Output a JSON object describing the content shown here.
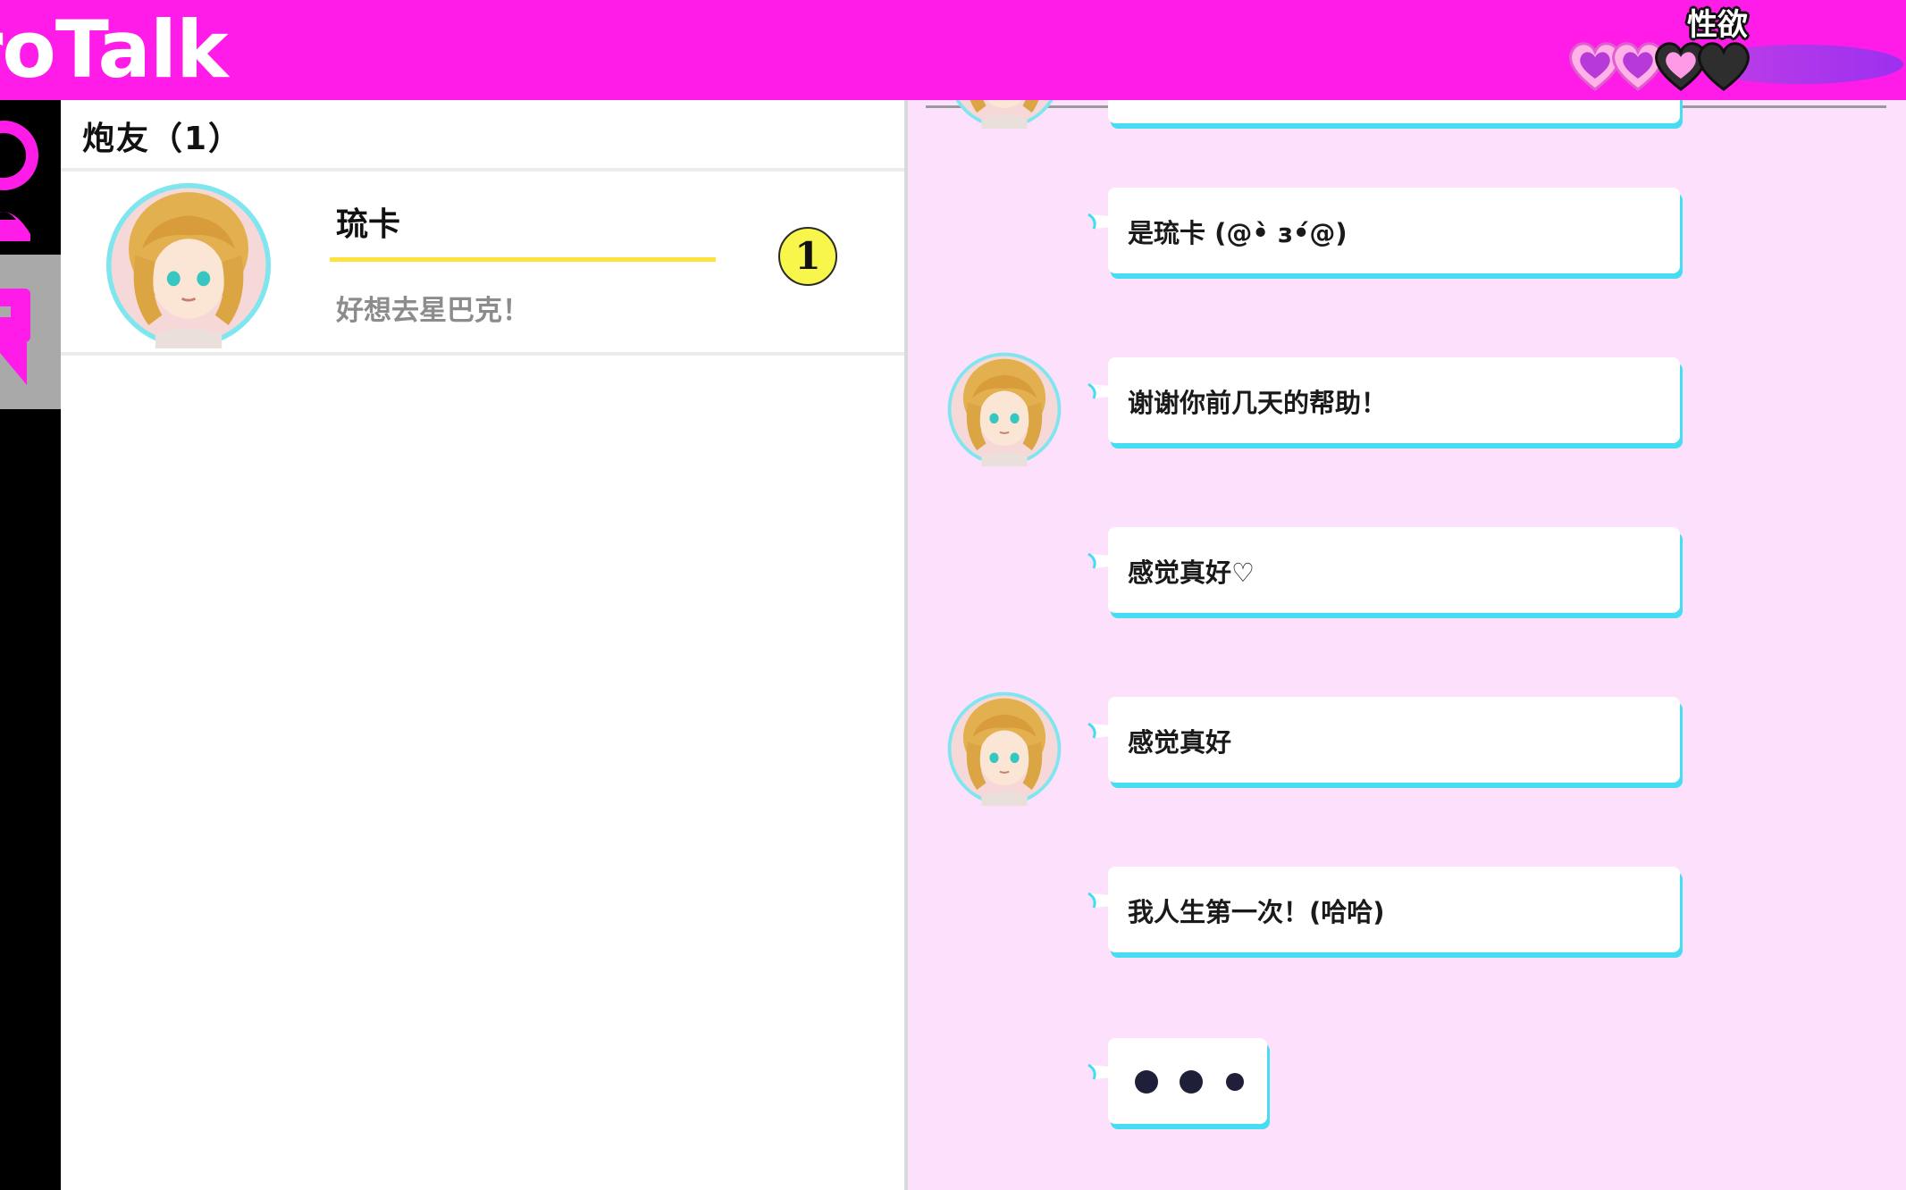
{
  "app": {
    "title": "roTalk"
  },
  "desire": {
    "label": "性欲",
    "hearts": [
      "pink",
      "pink",
      "pink-dark",
      "dark"
    ]
  },
  "sidebar": {
    "tabs": [
      {
        "icon": "person-icon"
      },
      {
        "icon": "chat-icon"
      }
    ]
  },
  "contacts": {
    "header": "炮友（1）",
    "items": [
      {
        "name": "琉卡",
        "preview": "好想去星巴克！",
        "unread": "1"
      }
    ]
  },
  "chat": {
    "messages": [
      {
        "text": "是琉卡 (@•̀ з•́@)",
        "show_avatar": false
      },
      {
        "text": "谢谢你前几天的帮助！",
        "show_avatar": true
      },
      {
        "text": "感觉真好♡",
        "show_avatar": false
      },
      {
        "text": "感觉真好",
        "show_avatar": true
      },
      {
        "text": "我人生第一次！(哈哈)",
        "show_avatar": false
      }
    ],
    "typing": true
  },
  "colors": {
    "brand": "#ff1ce8",
    "chat_bg": "#fde0fb",
    "accent_cyan": "#46dcf1",
    "highlight_yellow": "#ffe23b"
  }
}
